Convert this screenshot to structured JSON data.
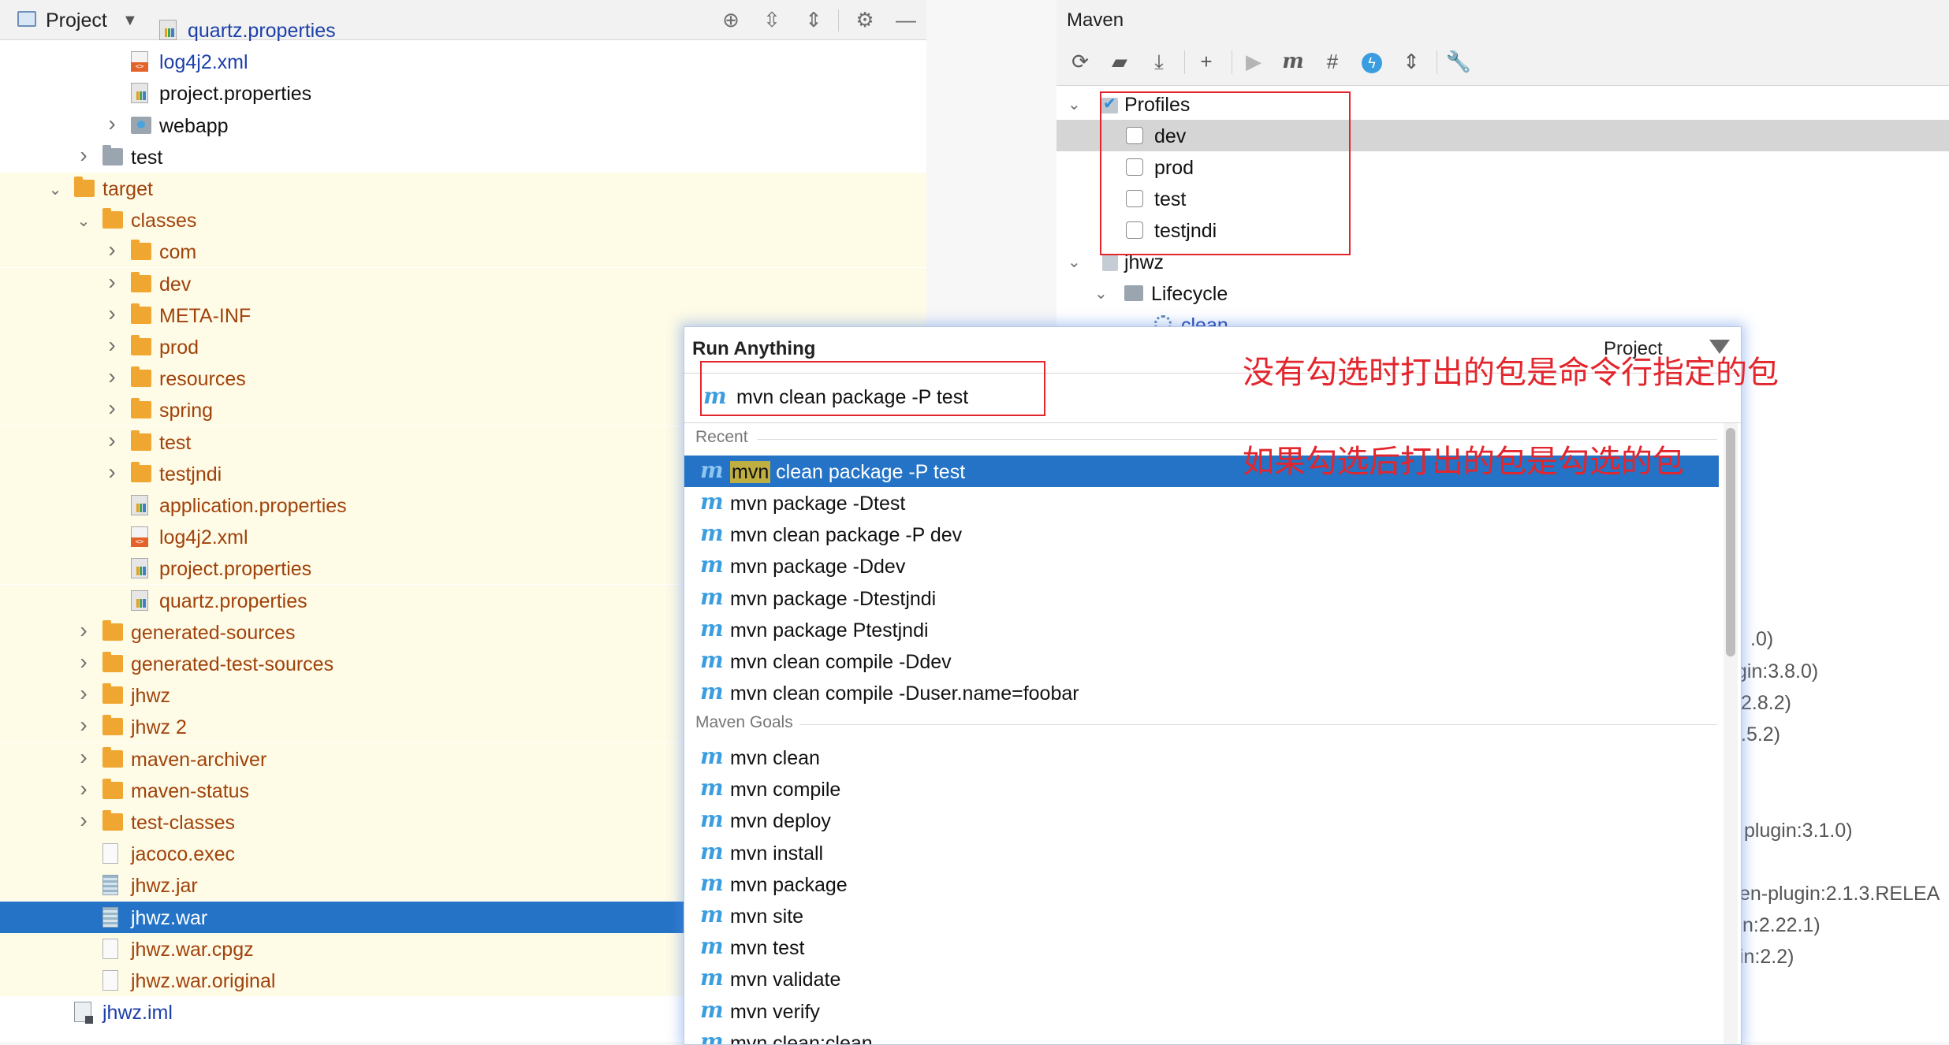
{
  "project_panel": {
    "title": "Project",
    "tree": [
      {
        "label": "quartz.properties",
        "icon": "properties-file-icon",
        "color": "blue",
        "indent": 3
      },
      {
        "label": "log4j2.xml",
        "icon": "xml-file-icon",
        "color": "blue",
        "indent": 2
      },
      {
        "label": "project.properties",
        "icon": "properties-file-icon",
        "color": "black",
        "indent": 2
      },
      {
        "label": "webapp",
        "icon": "web-folder-icon",
        "color": "black",
        "indent": 2,
        "expander": "collapsed"
      },
      {
        "label": "test",
        "icon": "folder-icon",
        "color": "black",
        "indent": 1,
        "expander": "collapsed"
      },
      {
        "label": "target",
        "icon": "folder-icon",
        "color": "brown",
        "indent": 0,
        "expander": "expanded",
        "bg": true
      },
      {
        "label": "classes",
        "icon": "folder-icon",
        "color": "brown",
        "indent": 1,
        "expander": "expanded",
        "bg": true
      },
      {
        "label": "com",
        "icon": "folder-icon",
        "color": "brown",
        "indent": 2,
        "expander": "collapsed",
        "bg": true
      },
      {
        "label": "dev",
        "icon": "folder-icon",
        "color": "brown",
        "indent": 2,
        "expander": "collapsed",
        "bg": true
      },
      {
        "label": "META-INF",
        "icon": "folder-icon",
        "color": "brown",
        "indent": 2,
        "expander": "collapsed",
        "bg": true
      },
      {
        "label": "prod",
        "icon": "folder-icon",
        "color": "brown",
        "indent": 2,
        "expander": "collapsed",
        "bg": true
      },
      {
        "label": "resources",
        "icon": "folder-icon",
        "color": "brown",
        "indent": 2,
        "expander": "collapsed",
        "bg": true
      },
      {
        "label": "spring",
        "icon": "folder-icon",
        "color": "brown",
        "indent": 2,
        "expander": "collapsed",
        "bg": true
      },
      {
        "label": "test",
        "icon": "folder-icon",
        "color": "brown",
        "indent": 2,
        "expander": "collapsed",
        "bg": true
      },
      {
        "label": "testjndi",
        "icon": "folder-icon",
        "color": "brown",
        "indent": 2,
        "expander": "collapsed",
        "bg": true
      },
      {
        "label": "application.properties",
        "icon": "properties-file-icon",
        "color": "brown",
        "indent": 2,
        "bg": true
      },
      {
        "label": "log4j2.xml",
        "icon": "xml-file-icon",
        "color": "brown",
        "indent": 2,
        "bg": true
      },
      {
        "label": "project.properties",
        "icon": "properties-file-icon",
        "color": "brown",
        "indent": 2,
        "bg": true
      },
      {
        "label": "quartz.properties",
        "icon": "properties-file-icon",
        "color": "brown",
        "indent": 2,
        "bg": true
      },
      {
        "label": "generated-sources",
        "icon": "folder-icon",
        "color": "brown",
        "indent": 1,
        "expander": "collapsed",
        "bg": true
      },
      {
        "label": "generated-test-sources",
        "icon": "folder-icon",
        "color": "brown",
        "indent": 1,
        "expander": "collapsed",
        "bg": true
      },
      {
        "label": "jhwz",
        "icon": "folder-icon",
        "color": "brown",
        "indent": 1,
        "expander": "collapsed",
        "bg": true
      },
      {
        "label": "jhwz 2",
        "icon": "folder-icon",
        "color": "brown",
        "indent": 1,
        "expander": "collapsed",
        "bg": true
      },
      {
        "label": "maven-archiver",
        "icon": "folder-icon",
        "color": "brown",
        "indent": 1,
        "expander": "collapsed",
        "bg": true
      },
      {
        "label": "maven-status",
        "icon": "folder-icon",
        "color": "brown",
        "indent": 1,
        "expander": "collapsed",
        "bg": true
      },
      {
        "label": "test-classes",
        "icon": "folder-icon",
        "color": "brown",
        "indent": 1,
        "expander": "collapsed",
        "bg": true
      },
      {
        "label": "jacoco.exec",
        "icon": "file-icon",
        "color": "brown",
        "indent": 1,
        "bg": true
      },
      {
        "label": "jhwz.jar",
        "icon": "jar-file-icon",
        "color": "brown",
        "indent": 1,
        "bg": true
      },
      {
        "label": "jhwz.war",
        "icon": "jar-file-icon",
        "color": "white",
        "indent": 1,
        "selected": true
      },
      {
        "label": "jhwz.war.cpgz",
        "icon": "file-icon",
        "color": "brown",
        "indent": 1,
        "bg": true
      },
      {
        "label": "jhwz.war.original",
        "icon": "file-icon",
        "color": "brown",
        "indent": 1,
        "bg": true
      },
      {
        "label": "jhwz.iml",
        "icon": "iml-file-icon",
        "color": "blue",
        "indent": 0
      }
    ]
  },
  "maven_panel": {
    "title": "Maven",
    "profiles_label": "Profiles",
    "profiles": [
      {
        "name": "dev",
        "checked": false,
        "selected": true
      },
      {
        "name": "prod",
        "checked": false
      },
      {
        "name": "test",
        "checked": false
      },
      {
        "name": "testjndi",
        "checked": false
      }
    ],
    "project_label": "jhwz",
    "lifecycle_label": "Lifecycle",
    "clean_label": "clean",
    "partial_rows": [
      ".0)",
      "gin:3.8.0)",
      "2.8.2)",
      ".5.2)",
      "plugin:3.1.0)",
      "en-plugin:2.1.3.RELEA",
      "n:2.22.1)",
      "in:2.2)"
    ]
  },
  "run_anything": {
    "title": "Run Anything",
    "scope": "Project",
    "input_value": "mvn clean package -P test",
    "recent_header": "Recent",
    "recent_first_highlight": "mvn",
    "recent_first_rest": " clean package -P test",
    "recent": [
      "mvn package -Dtest",
      "mvn clean package -P dev",
      "mvn package -Ddev",
      "mvn package -Dtestjndi",
      "mvn package Ptestjndi",
      "mvn clean compile -Ddev",
      "mvn clean compile -Duser.name=foobar"
    ],
    "goals_header": "Maven Goals",
    "goals": [
      "mvn clean",
      "mvn compile",
      "mvn deploy",
      "mvn install",
      "mvn package",
      "mvn site",
      "mvn test",
      "mvn validate",
      "mvn verify",
      "mvn clean:clean"
    ]
  },
  "annotations": {
    "note1": "没有勾选时打出的包是命令行指定的包",
    "note2": "如果勾选后打出的包是勾选的包",
    "color": "#e3262d"
  },
  "colors": {
    "selection": "#2473c6",
    "target_bg": "#fefbe6",
    "folder": "#f0a732",
    "maven_icon": "#3a9ddf"
  }
}
